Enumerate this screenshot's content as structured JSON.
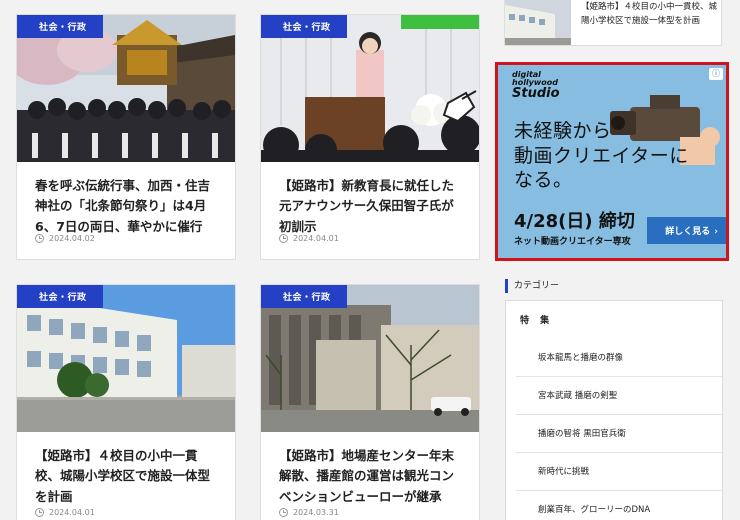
{
  "cards": [
    {
      "category": "社会・行政",
      "title": "春を呼ぶ伝統行事、加西・住吉神社の「北条節句祭り」は4月6、7日の両日、華やかに催行",
      "date": "2024.04.02"
    },
    {
      "category": "社会・行政",
      "title": "【姫路市】新教育長に就任した元アナウンサー久保田智子氏が初訓示",
      "date": "2024.04.01"
    },
    {
      "category": "社会・行政",
      "title": "【姫路市】４校目の小中一貫校、城陽小学校区で施設一体型を計画",
      "date": "2024.04.01"
    },
    {
      "category": "社会・行政",
      "title": "【姫路市】地場産センター年末解散、播産館の運営は観光コンベンションビューローが継承",
      "date": "2024.03.31"
    }
  ],
  "sidebar": {
    "related": {
      "title": "【姫路市】４校目の小中一貫校、城陽小学校区で施設一体型を計画"
    },
    "ad": {
      "logo_small": "digital",
      "logo_mid": "hollywood",
      "logo_big": "Studio",
      "info": "ⓘ",
      "line1": "未経験から",
      "line2": "動画クリエイターに",
      "line3": "なる。",
      "date": "4/28(日) 締切",
      "sub": "ネット動画クリエイター専攻",
      "button": "詳しく見る",
      "button_arrow": "›"
    },
    "categories_heading": "カテゴリー",
    "categories": {
      "parent": "特 集",
      "items": [
        "坂本龍馬と播磨の群像",
        "宮本武蔵 播磨の剣聖",
        "播磨の智将 黒田官兵衛",
        "新時代に挑戦",
        "創業百年、グローリーのDNA"
      ]
    }
  },
  "colors": {
    "category_badge": "#2440c4",
    "ad_border": "#d0141d",
    "ad_bg": "#86bde0",
    "ad_button": "#2a6fbf"
  }
}
